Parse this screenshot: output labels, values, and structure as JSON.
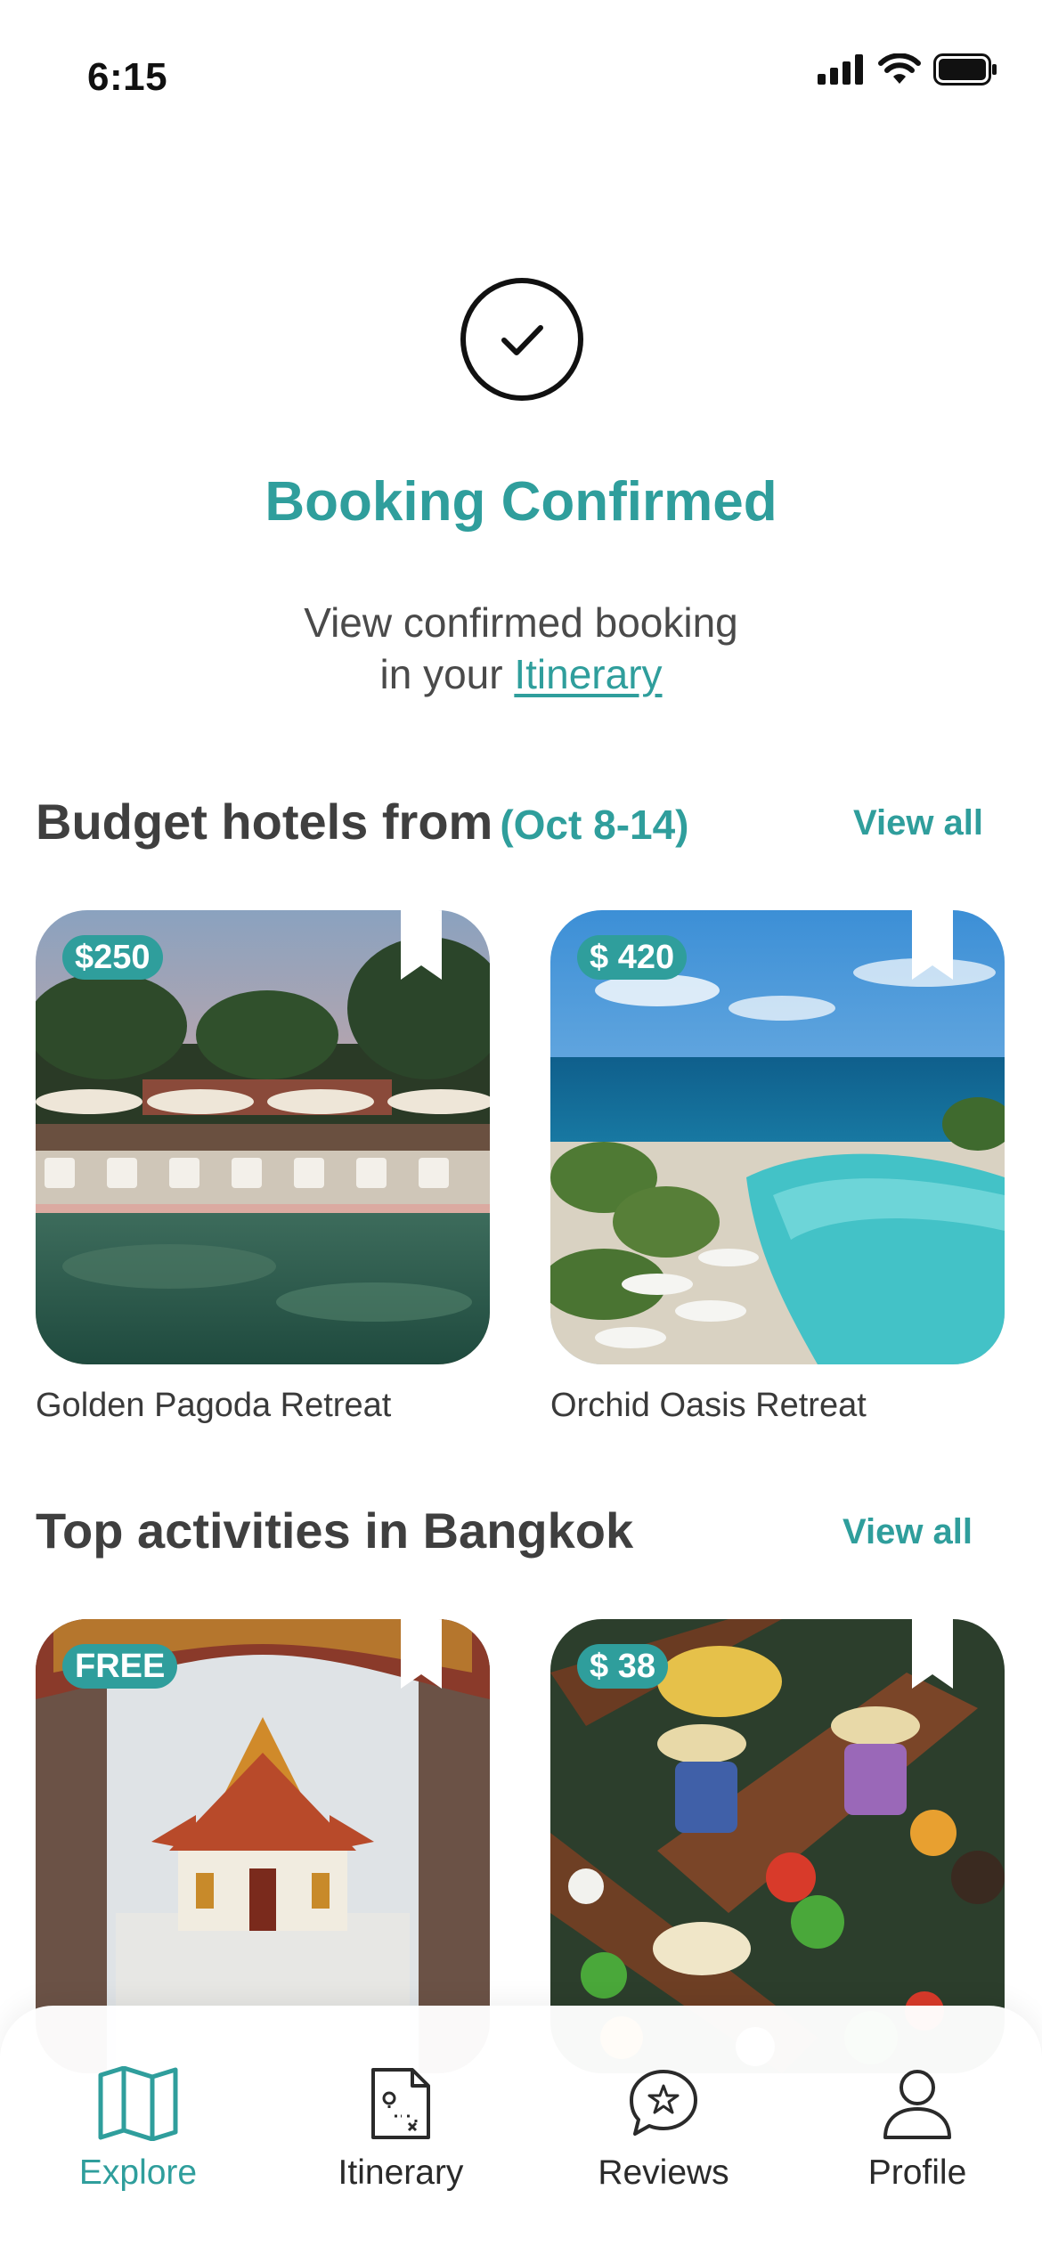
{
  "status_bar": {
    "time": "6:15"
  },
  "confirmation": {
    "title": "Booking Confirmed",
    "subtitle_line1": "View confirmed booking",
    "subtitle_line2_prefix": "in your",
    "itinerary_link": "Itinerary"
  },
  "hotels_section": {
    "title": "Budget hotels from",
    "dates": "(Oct 8-14)",
    "view_all": "View all",
    "items": [
      {
        "price": "$250",
        "name": "Golden Pagoda Retreat"
      },
      {
        "price": "$ 420",
        "name": "Orchid Oasis Retreat"
      }
    ]
  },
  "activities_section": {
    "title": "Top activities in Bangkok",
    "view_all": "View all",
    "items": [
      {
        "price": "FREE"
      },
      {
        "price": "$ 38"
      }
    ]
  },
  "tabbar": {
    "tabs": [
      {
        "label": "Explore",
        "icon": "map-icon",
        "active": true
      },
      {
        "label": "Itinerary",
        "icon": "itinerary-doc-icon",
        "active": false
      },
      {
        "label": "Reviews",
        "icon": "reviews-star-bubble-icon",
        "active": false
      },
      {
        "label": "Profile",
        "icon": "profile-user-icon",
        "active": false
      }
    ]
  },
  "colors": {
    "accent": "#2f9e9c",
    "text": "#3f3f3f",
    "background": "#ffffff"
  }
}
